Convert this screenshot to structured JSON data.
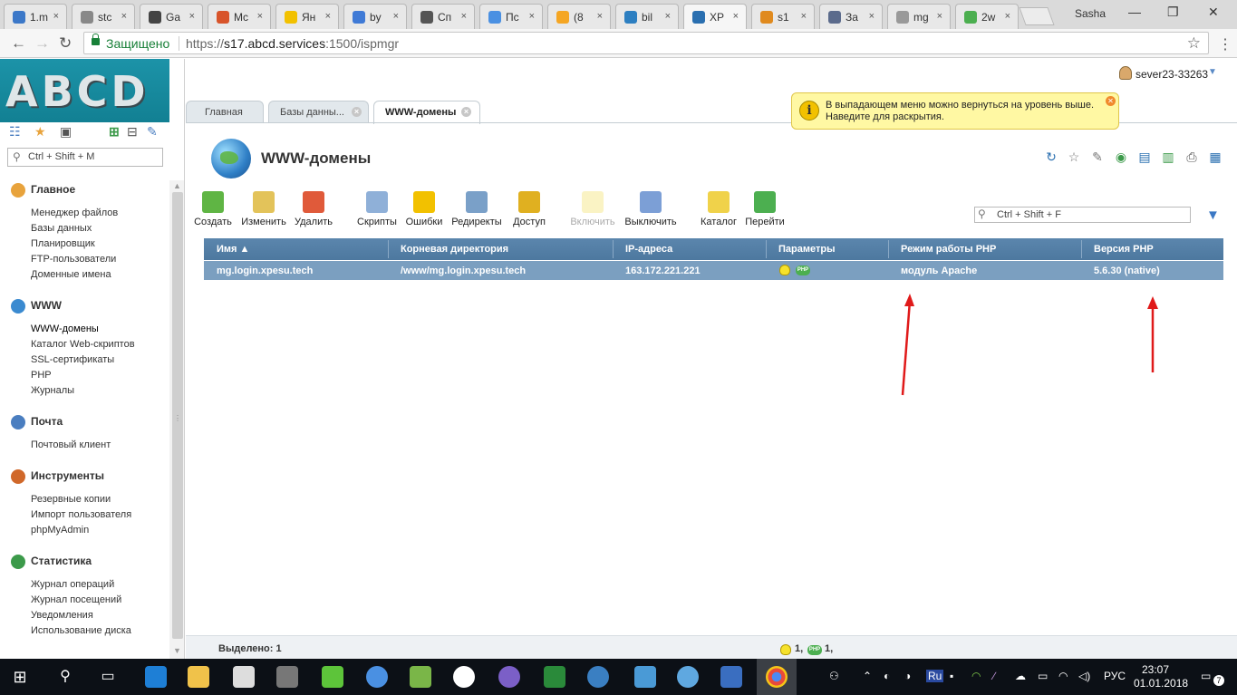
{
  "browser": {
    "tabs": [
      {
        "label": "1.m",
        "color": "#3c78c8"
      },
      {
        "label": "stc",
        "color": "#888888"
      },
      {
        "label": "Ga",
        "color": "#444444"
      },
      {
        "label": "Mc",
        "color": "#d8542a"
      },
      {
        "label": "Ян",
        "color": "#f2c100"
      },
      {
        "label": "by",
        "color": "#3f7ad6"
      },
      {
        "label": "Сп",
        "color": "#555555"
      },
      {
        "label": "Пс",
        "color": "#4a90e2"
      },
      {
        "label": "(8",
        "color": "#f5a623"
      },
      {
        "label": "bil",
        "color": "#2d7fc1"
      },
      {
        "label": "XP",
        "color": "#2a6fb0"
      },
      {
        "label": "s1",
        "color": "#e08a1e"
      },
      {
        "label": "За",
        "color": "#5b6b8c"
      },
      {
        "label": "mg",
        "color": "#999999"
      },
      {
        "label": "2w",
        "color": "#4caf50"
      }
    ],
    "window_user": "Sasha",
    "secure_label": "Защищено",
    "url_prefix": "https://",
    "url_host": "s17.abcd.services",
    "url_rest": ":1500/ispmgr"
  },
  "sidebar": {
    "logo_text": "ABCD",
    "search_placeholder": "Ctrl + Shift + M",
    "groups": [
      {
        "title": "Главное",
        "icon": "home-icon",
        "color": "#e8a33c",
        "items": [
          "Менеджер файлов",
          "Базы данных",
          "Планировщик",
          "FTP-пользователи",
          "Доменные имена"
        ]
      },
      {
        "title": "WWW",
        "icon": "www-globe-icon",
        "color": "#3a8ad0",
        "items": [
          "WWW-домены",
          "Каталог Web-скриптов",
          "SSL-сертификаты",
          "PHP",
          "Журналы"
        ]
      },
      {
        "title": "Почта",
        "icon": "mail-icon",
        "color": "#4a7ec0",
        "items": [
          "Почтовый клиент"
        ]
      },
      {
        "title": "Инструменты",
        "icon": "tools-icon",
        "color": "#d0682a",
        "items": [
          "Резервные копии",
          "Импорт пользователя",
          "phpMyAdmin"
        ]
      },
      {
        "title": "Статистика",
        "icon": "statistics-icon",
        "color": "#3c9a4a",
        "items": [
          "Журнал операций",
          "Журнал посещений",
          "Уведомления",
          "Использование диска"
        ]
      }
    ]
  },
  "header": {
    "username": "sever23-33263",
    "tabs": [
      {
        "label": "Главная",
        "closable": false
      },
      {
        "label": "Базы данны...",
        "closable": true
      },
      {
        "label": "WWW-домены",
        "closable": true
      }
    ],
    "tooltip": "В выпадающем меню можно вернуться на уровень выше. Наведите для раскрытия."
  },
  "page": {
    "title": "WWW-домены",
    "toolbar": [
      {
        "label": "Создать",
        "icon": "create-icon",
        "color": "#5fb544",
        "disabled": false
      },
      {
        "label": "Изменить",
        "icon": "edit-icon",
        "color": "#e3c35a",
        "disabled": false
      },
      {
        "label": "Удалить",
        "icon": "delete-icon",
        "color": "#e05a3a",
        "disabled": false
      },
      {
        "label": "Скрипты",
        "icon": "scripts-icon",
        "color": "#8fb0d8",
        "disabled": false
      },
      {
        "label": "Ошибки",
        "icon": "errors-icon",
        "color": "#f2c100",
        "disabled": false
      },
      {
        "label": "Редиректы",
        "icon": "redirects-icon",
        "color": "#7aa0c8",
        "disabled": false
      },
      {
        "label": "Доступ",
        "icon": "access-lock-icon",
        "color": "#e0b020",
        "disabled": false
      },
      {
        "label": "Включить",
        "icon": "enable-bulb-icon",
        "color": "#f6e78a",
        "disabled": true
      },
      {
        "label": "Выключить",
        "icon": "disable-bulb-icon",
        "color": "#7c9fd6",
        "disabled": false
      },
      {
        "label": "Каталог",
        "icon": "folder-icon",
        "color": "#f0d24a",
        "disabled": false
      },
      {
        "label": "Перейти",
        "icon": "goto-arrow-icon",
        "color": "#4caf50",
        "disabled": false
      }
    ],
    "table_search_placeholder": "Ctrl + Shift + F",
    "columns": [
      "Имя",
      "Корневая директория",
      "IP-адреса",
      "Параметры",
      "Режим работы PHP",
      "Версия PHP"
    ],
    "rows": [
      {
        "name": "mg.login.xpesu.tech",
        "root": "/www/mg.login.xpesu.tech",
        "ip": "163.172.221.221",
        "php_mode": "модуль Apache",
        "php_version": "5.6.30 (native)"
      }
    ],
    "status": {
      "selected": "Выделено: 1",
      "count_bulb": "1,",
      "count_php": "1,"
    },
    "php_badge": "PHP",
    "annotation_arrow_color": "#e01a1a"
  },
  "taskbar": {
    "lang": "РУС",
    "time": "23:07",
    "date": "01.01.2018",
    "notifications": "7"
  }
}
